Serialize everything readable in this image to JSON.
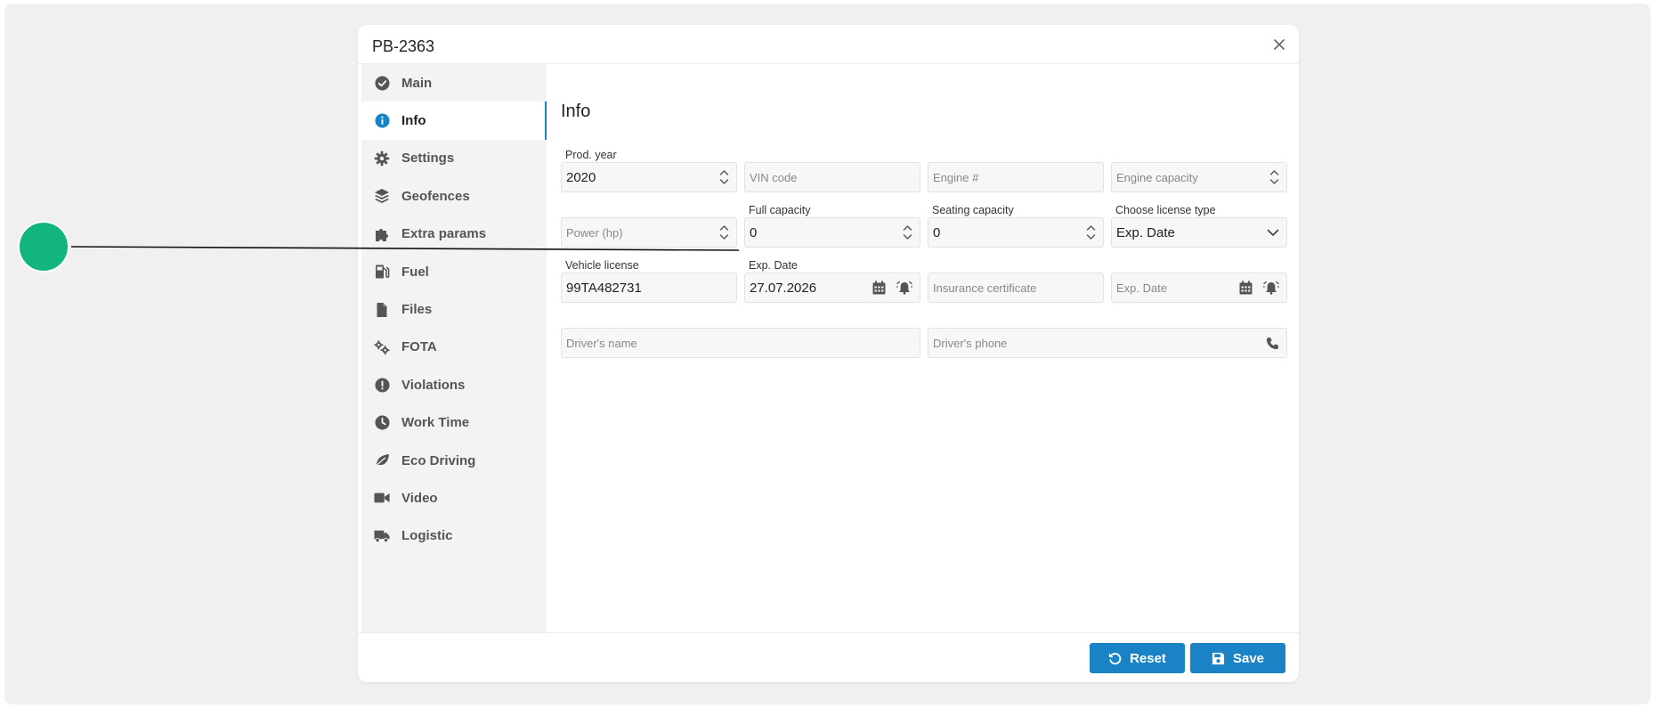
{
  "window": {
    "title": "PB-2363"
  },
  "sidebar": {
    "items": [
      {
        "label": "Main",
        "icon": "check-circle-icon"
      },
      {
        "label": "Info",
        "icon": "info-icon",
        "active": true
      },
      {
        "label": "Settings",
        "icon": "gear-icon"
      },
      {
        "label": "Geofences",
        "icon": "layers-icon"
      },
      {
        "label": "Extra params",
        "icon": "puzzle-icon"
      },
      {
        "label": "Fuel",
        "icon": "fuel-pump-icon"
      },
      {
        "label": "Files",
        "icon": "file-icon"
      },
      {
        "label": "FOTA",
        "icon": "gears-icon"
      },
      {
        "label": "Violations",
        "icon": "exclamation-icon"
      },
      {
        "label": "Work Time",
        "icon": "clock-icon"
      },
      {
        "label": "Eco Driving",
        "icon": "leaf-icon"
      },
      {
        "label": "Video",
        "icon": "video-icon"
      },
      {
        "label": "Logistic",
        "icon": "truck-icon"
      }
    ]
  },
  "info": {
    "title": "Info",
    "prod_year": {
      "label": "Prod. year",
      "value": "2020"
    },
    "vin_code": {
      "placeholder": "VIN code"
    },
    "engine_number": {
      "placeholder": "Engine #"
    },
    "engine_capacity": {
      "placeholder": "Engine capacity"
    },
    "power": {
      "placeholder": "Power (hp)"
    },
    "full_capacity": {
      "label": "Full capacity",
      "value": "0"
    },
    "seating_capacity": {
      "label": "Seating capacity",
      "value": "0"
    },
    "license_type": {
      "label": "Choose license type",
      "value": "Exp. Date"
    },
    "vehicle_license": {
      "label": "Vehicle license",
      "value": "99TA482731"
    },
    "license_exp_date": {
      "label": "Exp. Date",
      "value": "27.07.2026"
    },
    "insurance_certificate": {
      "placeholder": "Insurance certificate"
    },
    "insurance_exp_date": {
      "placeholder": "Exp. Date"
    },
    "driver_name": {
      "placeholder": "Driver's name"
    },
    "driver_phone": {
      "placeholder": "Driver's phone"
    }
  },
  "footer": {
    "reset_label": "Reset",
    "save_label": "Save"
  },
  "colors": {
    "accent": "#1a83c6",
    "marker": "#12b57f",
    "background": "#f0f0f0"
  }
}
